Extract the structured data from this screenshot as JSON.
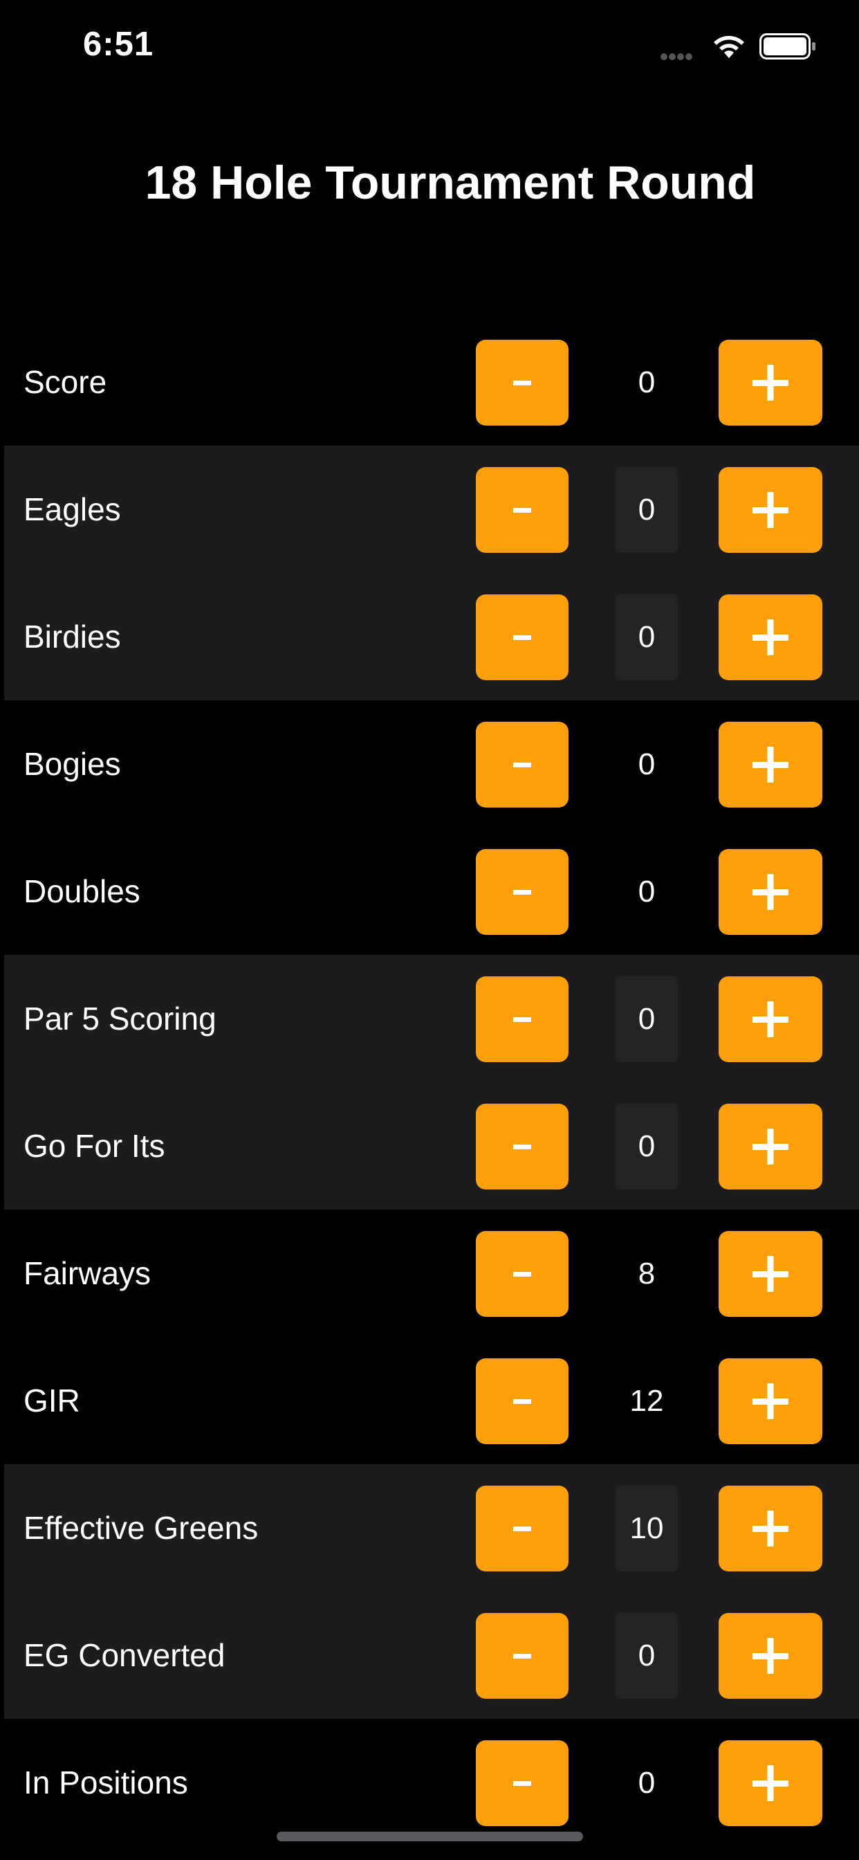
{
  "status_bar": {
    "time": "6:51"
  },
  "header": {
    "title": "18 Hole Tournament Round"
  },
  "colors": {
    "accent": "#ff9f0a",
    "background": "#000000",
    "row_shade": "#1c1c1e"
  },
  "icons": {
    "minus": "minus-icon",
    "plus": "plus-icon",
    "wifi": "wifi-icon",
    "battery": "battery-icon",
    "signal": "signal-icon"
  },
  "stats": [
    {
      "label": "Score",
      "value": "0"
    },
    {
      "label": "Eagles",
      "value": "0"
    },
    {
      "label": "Birdies",
      "value": "0"
    },
    {
      "label": "Bogies",
      "value": "0"
    },
    {
      "label": "Doubles",
      "value": "0"
    },
    {
      "label": "Par 5 Scoring",
      "value": "0"
    },
    {
      "label": "Go For Its",
      "value": "0"
    },
    {
      "label": "Fairways",
      "value": "8"
    },
    {
      "label": "GIR",
      "value": "12"
    },
    {
      "label": "Effective Greens",
      "value": "10"
    },
    {
      "label": "EG Converted",
      "value": "0"
    },
    {
      "label": "In Positions",
      "value": "0"
    }
  ]
}
